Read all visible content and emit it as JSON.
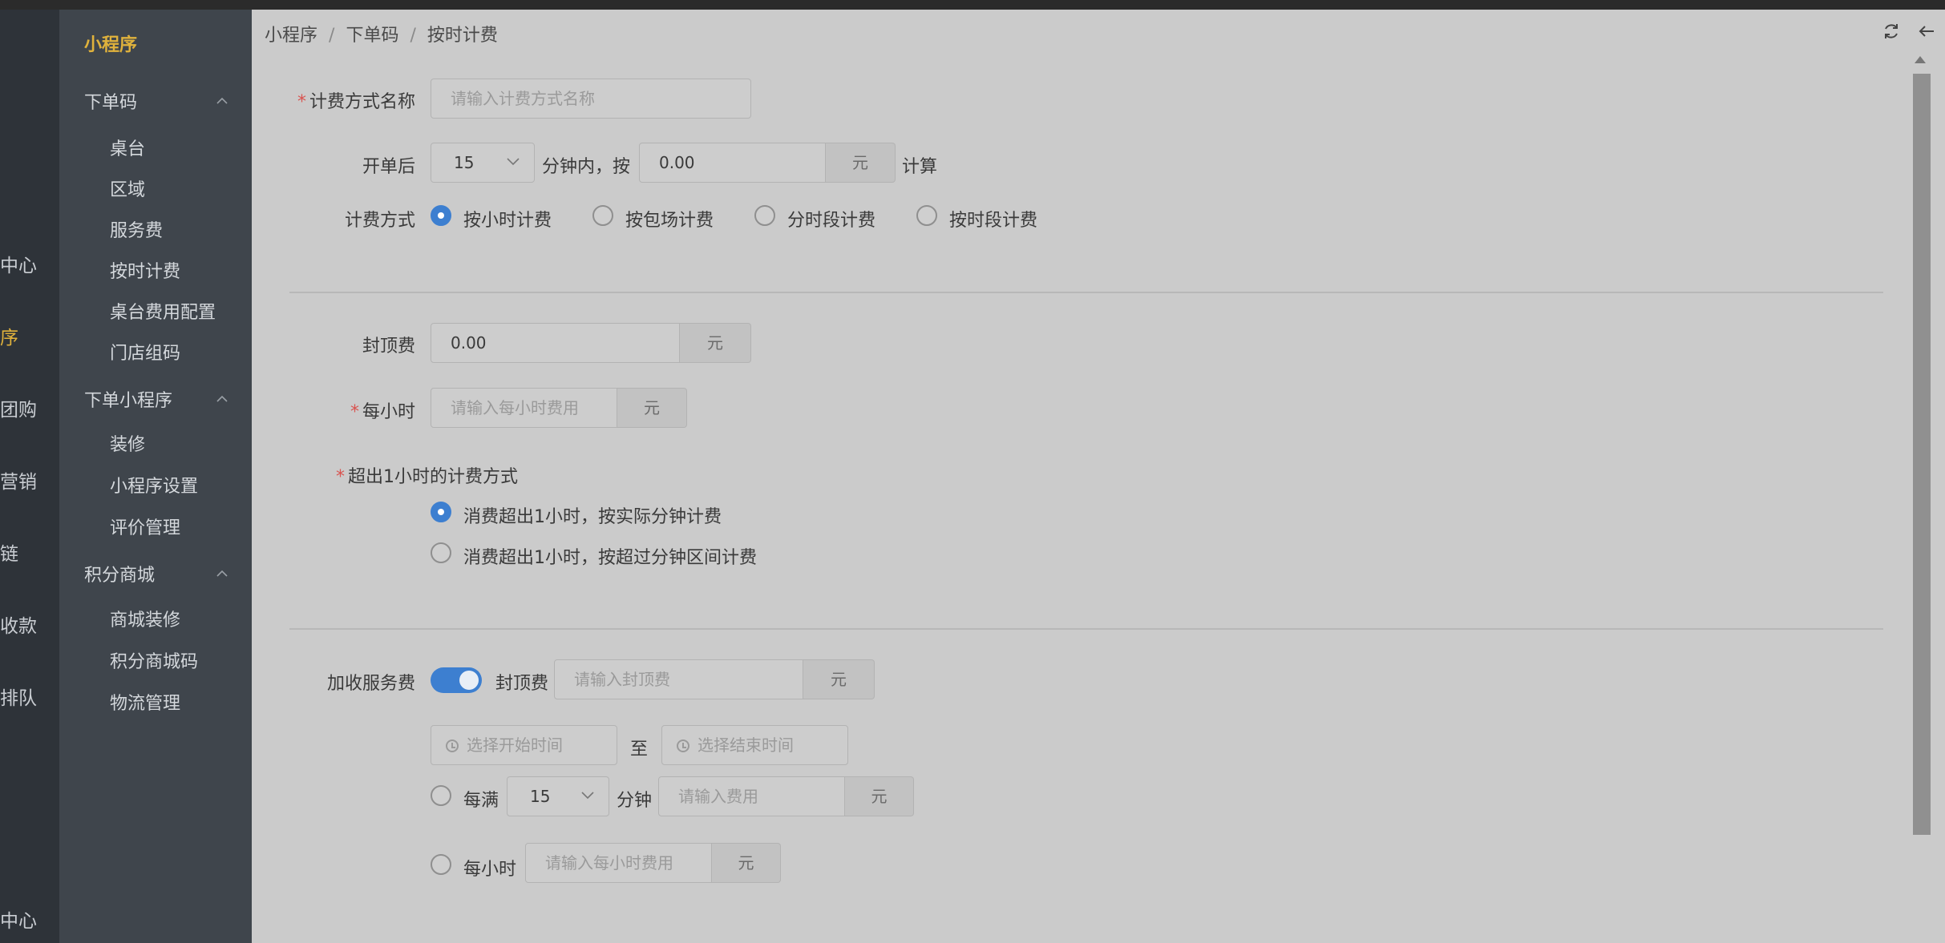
{
  "primary_nav": {
    "items": [
      {
        "label": "中心"
      },
      {
        "label": "序"
      },
      {
        "label": "团购"
      },
      {
        "label": "营销"
      },
      {
        "label": "链"
      },
      {
        "label": "收款"
      },
      {
        "label": "排队"
      },
      {
        "label": "中心"
      }
    ]
  },
  "sub_nav": {
    "title": "小程序",
    "groups": [
      {
        "label": "下单码",
        "items": [
          "桌台",
          "区域",
          "服务费",
          "按时计费",
          "桌台费用配置",
          "门店组码"
        ]
      },
      {
        "label": "下单小程序",
        "items": [
          "装修",
          "小程序设置",
          "评价管理"
        ]
      },
      {
        "label": "积分商城",
        "items": [
          "商城装修",
          "积分商城码",
          "物流管理"
        ]
      }
    ]
  },
  "breadcrumb": {
    "items": [
      "小程序",
      "下单码",
      "按时计费"
    ],
    "sep": "/"
  },
  "form": {
    "name_label": "计费方式名称",
    "name_placeholder": "请输入计费方式名称",
    "open_label": "开单后",
    "open_select": "15",
    "open_mid": "分钟内，按",
    "open_value": "0.00",
    "yuan": "元",
    "open_suffix": "计算",
    "mode_label": "计费方式",
    "modes": [
      "按小时计费",
      "按包场计费",
      "分时段计费",
      "按时段计费"
    ],
    "cap_label": "封顶费",
    "cap_value": "0.00",
    "hourly_label": "每小时",
    "hourly_placeholder": "请输入每小时费用",
    "over_label": "超出1小时的计费方式",
    "over_options": [
      "消费超出1小时，按实际分钟计费",
      "消费超出1小时，按超过分钟区间计费"
    ],
    "service_label": "加收服务费",
    "service_cap_label": "封顶费",
    "service_cap_placeholder": "请输入封顶费",
    "start_placeholder": "选择开始时间",
    "to": "至",
    "end_placeholder": "选择结束时间",
    "every_label": "每满",
    "every_select": "15",
    "minute_label": "分钟",
    "fee_placeholder": "请输入费用",
    "per_hour_label": "每小时",
    "per_hour_placeholder": "请输入每小时费用"
  },
  "colors": {
    "accent": "#3d7fd0",
    "brand": "#e0b23c",
    "required": "#d9534f"
  }
}
